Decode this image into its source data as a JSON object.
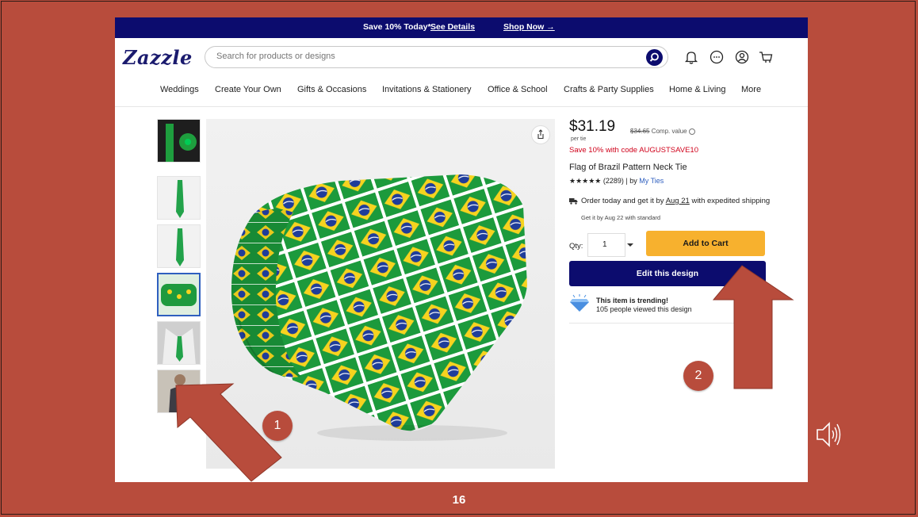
{
  "colors": {
    "slide_bg": "#b84c3c",
    "brand_navy": "#0c0c6e",
    "cart_yellow": "#f7b12e",
    "promo_red": "#d0021b",
    "link_blue": "#2f5fbf"
  },
  "promo_bar": {
    "text": "Save 10% Today*",
    "details_link": "See Details",
    "shop_link": "Shop Now →"
  },
  "header": {
    "logo": "Zazzle",
    "search": {
      "placeholder": "Search for products or designs"
    },
    "icons": [
      "search-icon",
      "bell-icon",
      "chat-icon",
      "account-icon",
      "cart-icon"
    ]
  },
  "nav": {
    "items": [
      "Weddings",
      "Create Your Own",
      "Gifts & Occasions",
      "Invitations & Stationery",
      "Office & School",
      "Crafts & Party Supplies",
      "Home & Living",
      "More"
    ]
  },
  "product": {
    "price": "$31.19",
    "comp_price": "$34.65",
    "comp_label": "Comp. value",
    "per_unit": "per tie",
    "promo": "Save 10% with code AUGUSTSAVE10",
    "title": "Flag of Brazil Pattern Neck Tie",
    "stars": "★★★★★",
    "review_count": "(2289)",
    "by_label": "| by",
    "seller": "My Ties",
    "ship_prefix": "Order today and get it by",
    "ship_date": "Aug 21",
    "ship_suffix": "with expedited shipping",
    "ship_standard": "Get it by Aug 22 with standard",
    "qty_label": "Qty:",
    "qty_value": "1",
    "add_to_cart": "Add to Cart",
    "edit_design": "Edit this design",
    "trending_title": "This item is trending!",
    "trending_sub": "105 people viewed this design"
  },
  "annotations": {
    "badge1": "1",
    "badge2": "2",
    "slide_number": "16"
  }
}
